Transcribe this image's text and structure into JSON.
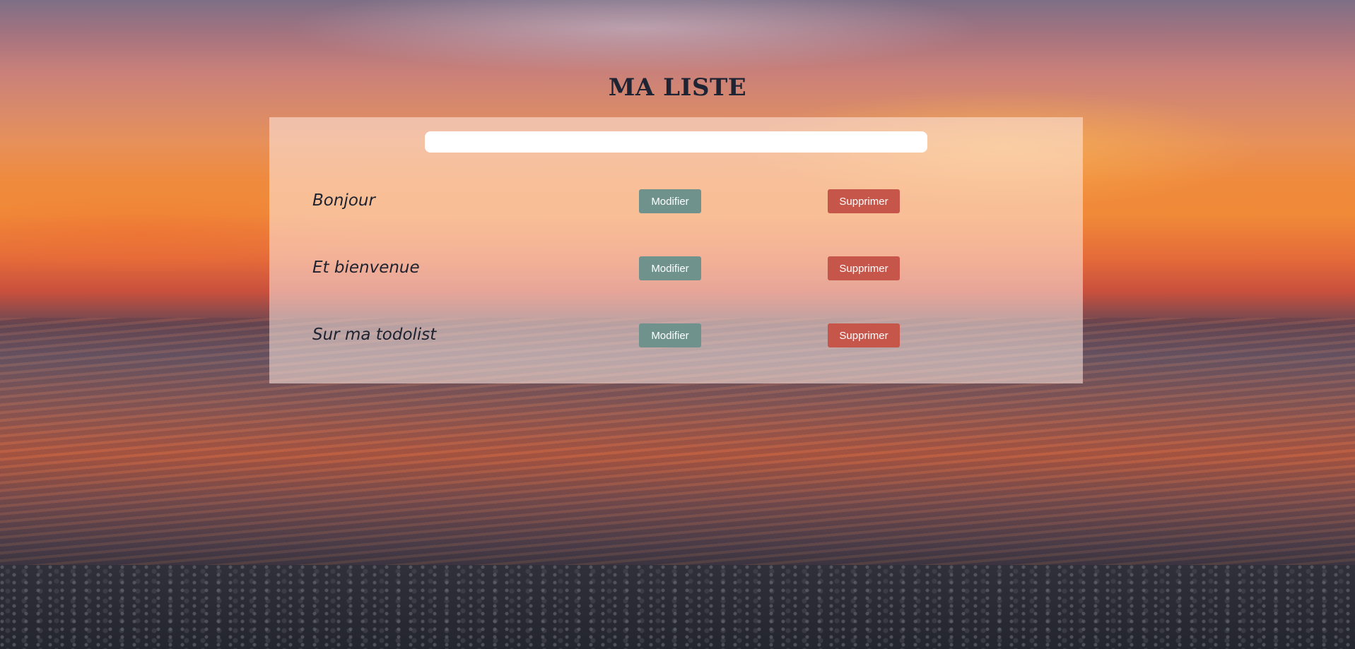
{
  "page": {
    "title": "MA LISTE"
  },
  "new_task": {
    "value": "",
    "placeholder": ""
  },
  "tasks": [
    {
      "label": "Bonjour",
      "edit_label": "Modifier",
      "delete_label": "Supprimer"
    },
    {
      "label": "Et bienvenue",
      "edit_label": "Modifier",
      "delete_label": "Supprimer"
    },
    {
      "label": "Sur ma todolist",
      "edit_label": "Modifier",
      "delete_label": "Supprimer"
    }
  ],
  "colors": {
    "title": "#1e2433",
    "edit_button": "#6f938c",
    "delete_button": "#c6554a",
    "panel": "rgba(255,235,228,0.55)"
  }
}
